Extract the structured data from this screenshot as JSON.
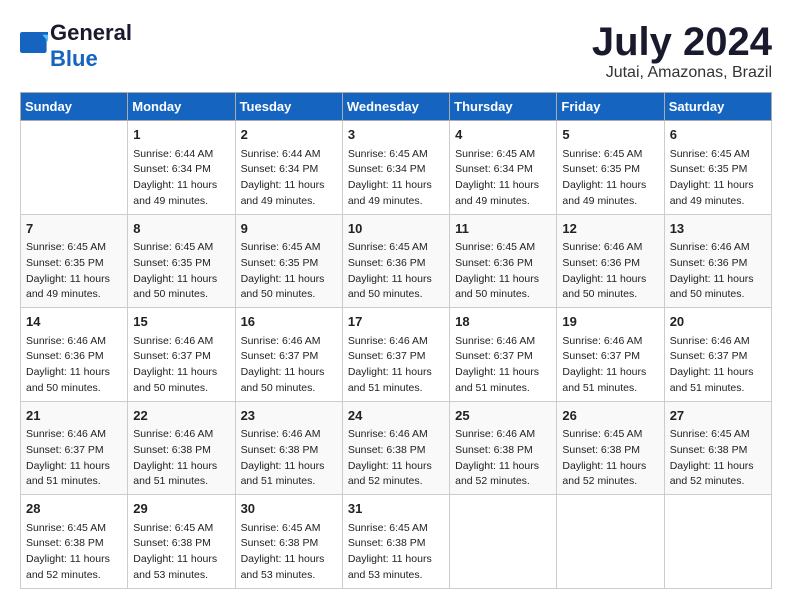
{
  "header": {
    "logo_general": "General",
    "logo_blue": "Blue",
    "month_title": "July 2024",
    "location": "Jutai, Amazonas, Brazil"
  },
  "weekdays": [
    "Sunday",
    "Monday",
    "Tuesday",
    "Wednesday",
    "Thursday",
    "Friday",
    "Saturday"
  ],
  "weeks": [
    [
      {
        "day": "",
        "sunrise": "",
        "sunset": "",
        "daylight": ""
      },
      {
        "day": "1",
        "sunrise": "Sunrise: 6:44 AM",
        "sunset": "Sunset: 6:34 PM",
        "daylight": "Daylight: 11 hours and 49 minutes."
      },
      {
        "day": "2",
        "sunrise": "Sunrise: 6:44 AM",
        "sunset": "Sunset: 6:34 PM",
        "daylight": "Daylight: 11 hours and 49 minutes."
      },
      {
        "day": "3",
        "sunrise": "Sunrise: 6:45 AM",
        "sunset": "Sunset: 6:34 PM",
        "daylight": "Daylight: 11 hours and 49 minutes."
      },
      {
        "day": "4",
        "sunrise": "Sunrise: 6:45 AM",
        "sunset": "Sunset: 6:34 PM",
        "daylight": "Daylight: 11 hours and 49 minutes."
      },
      {
        "day": "5",
        "sunrise": "Sunrise: 6:45 AM",
        "sunset": "Sunset: 6:35 PM",
        "daylight": "Daylight: 11 hours and 49 minutes."
      },
      {
        "day": "6",
        "sunrise": "Sunrise: 6:45 AM",
        "sunset": "Sunset: 6:35 PM",
        "daylight": "Daylight: 11 hours and 49 minutes."
      }
    ],
    [
      {
        "day": "7",
        "sunrise": "Sunrise: 6:45 AM",
        "sunset": "Sunset: 6:35 PM",
        "daylight": "Daylight: 11 hours and 49 minutes."
      },
      {
        "day": "8",
        "sunrise": "Sunrise: 6:45 AM",
        "sunset": "Sunset: 6:35 PM",
        "daylight": "Daylight: 11 hours and 50 minutes."
      },
      {
        "day": "9",
        "sunrise": "Sunrise: 6:45 AM",
        "sunset": "Sunset: 6:35 PM",
        "daylight": "Daylight: 11 hours and 50 minutes."
      },
      {
        "day": "10",
        "sunrise": "Sunrise: 6:45 AM",
        "sunset": "Sunset: 6:36 PM",
        "daylight": "Daylight: 11 hours and 50 minutes."
      },
      {
        "day": "11",
        "sunrise": "Sunrise: 6:45 AM",
        "sunset": "Sunset: 6:36 PM",
        "daylight": "Daylight: 11 hours and 50 minutes."
      },
      {
        "day": "12",
        "sunrise": "Sunrise: 6:46 AM",
        "sunset": "Sunset: 6:36 PM",
        "daylight": "Daylight: 11 hours and 50 minutes."
      },
      {
        "day": "13",
        "sunrise": "Sunrise: 6:46 AM",
        "sunset": "Sunset: 6:36 PM",
        "daylight": "Daylight: 11 hours and 50 minutes."
      }
    ],
    [
      {
        "day": "14",
        "sunrise": "Sunrise: 6:46 AM",
        "sunset": "Sunset: 6:36 PM",
        "daylight": "Daylight: 11 hours and 50 minutes."
      },
      {
        "day": "15",
        "sunrise": "Sunrise: 6:46 AM",
        "sunset": "Sunset: 6:37 PM",
        "daylight": "Daylight: 11 hours and 50 minutes."
      },
      {
        "day": "16",
        "sunrise": "Sunrise: 6:46 AM",
        "sunset": "Sunset: 6:37 PM",
        "daylight": "Daylight: 11 hours and 50 minutes."
      },
      {
        "day": "17",
        "sunrise": "Sunrise: 6:46 AM",
        "sunset": "Sunset: 6:37 PM",
        "daylight": "Daylight: 11 hours and 51 minutes."
      },
      {
        "day": "18",
        "sunrise": "Sunrise: 6:46 AM",
        "sunset": "Sunset: 6:37 PM",
        "daylight": "Daylight: 11 hours and 51 minutes."
      },
      {
        "day": "19",
        "sunrise": "Sunrise: 6:46 AM",
        "sunset": "Sunset: 6:37 PM",
        "daylight": "Daylight: 11 hours and 51 minutes."
      },
      {
        "day": "20",
        "sunrise": "Sunrise: 6:46 AM",
        "sunset": "Sunset: 6:37 PM",
        "daylight": "Daylight: 11 hours and 51 minutes."
      }
    ],
    [
      {
        "day": "21",
        "sunrise": "Sunrise: 6:46 AM",
        "sunset": "Sunset: 6:37 PM",
        "daylight": "Daylight: 11 hours and 51 minutes."
      },
      {
        "day": "22",
        "sunrise": "Sunrise: 6:46 AM",
        "sunset": "Sunset: 6:38 PM",
        "daylight": "Daylight: 11 hours and 51 minutes."
      },
      {
        "day": "23",
        "sunrise": "Sunrise: 6:46 AM",
        "sunset": "Sunset: 6:38 PM",
        "daylight": "Daylight: 11 hours and 51 minutes."
      },
      {
        "day": "24",
        "sunrise": "Sunrise: 6:46 AM",
        "sunset": "Sunset: 6:38 PM",
        "daylight": "Daylight: 11 hours and 52 minutes."
      },
      {
        "day": "25",
        "sunrise": "Sunrise: 6:46 AM",
        "sunset": "Sunset: 6:38 PM",
        "daylight": "Daylight: 11 hours and 52 minutes."
      },
      {
        "day": "26",
        "sunrise": "Sunrise: 6:45 AM",
        "sunset": "Sunset: 6:38 PM",
        "daylight": "Daylight: 11 hours and 52 minutes."
      },
      {
        "day": "27",
        "sunrise": "Sunrise: 6:45 AM",
        "sunset": "Sunset: 6:38 PM",
        "daylight": "Daylight: 11 hours and 52 minutes."
      }
    ],
    [
      {
        "day": "28",
        "sunrise": "Sunrise: 6:45 AM",
        "sunset": "Sunset: 6:38 PM",
        "daylight": "Daylight: 11 hours and 52 minutes."
      },
      {
        "day": "29",
        "sunrise": "Sunrise: 6:45 AM",
        "sunset": "Sunset: 6:38 PM",
        "daylight": "Daylight: 11 hours and 53 minutes."
      },
      {
        "day": "30",
        "sunrise": "Sunrise: 6:45 AM",
        "sunset": "Sunset: 6:38 PM",
        "daylight": "Daylight: 11 hours and 53 minutes."
      },
      {
        "day": "31",
        "sunrise": "Sunrise: 6:45 AM",
        "sunset": "Sunset: 6:38 PM",
        "daylight": "Daylight: 11 hours and 53 minutes."
      },
      {
        "day": "",
        "sunrise": "",
        "sunset": "",
        "daylight": ""
      },
      {
        "day": "",
        "sunrise": "",
        "sunset": "",
        "daylight": ""
      },
      {
        "day": "",
        "sunrise": "",
        "sunset": "",
        "daylight": ""
      }
    ]
  ]
}
